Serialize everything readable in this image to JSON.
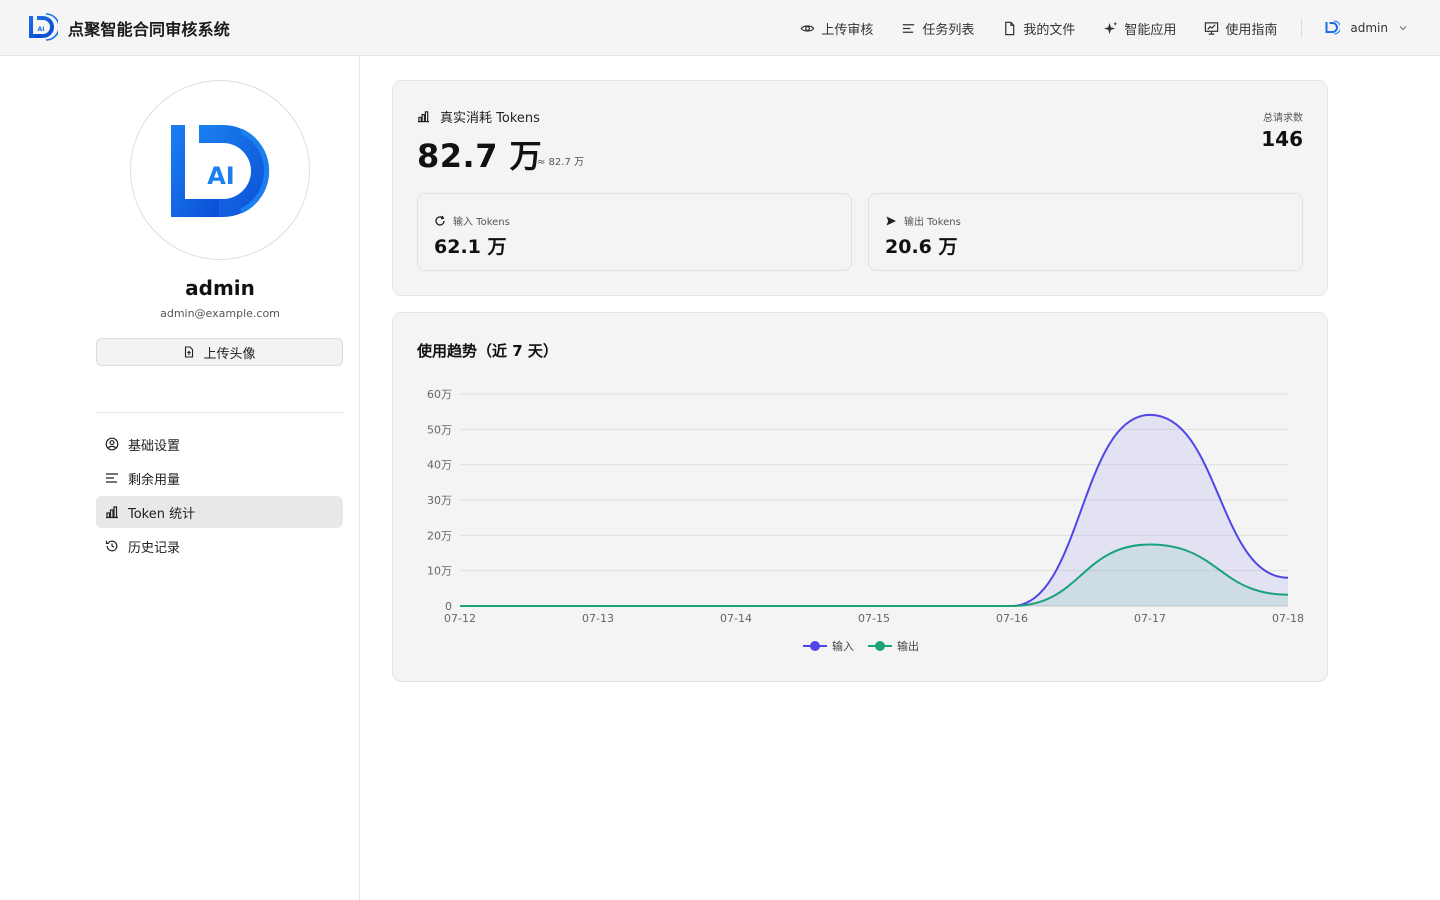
{
  "app": {
    "title": "点聚智能合同审核系统"
  },
  "nav": {
    "items": [
      {
        "label": "上传审核",
        "icon": "eye-icon"
      },
      {
        "label": "任务列表",
        "icon": "list-icon"
      },
      {
        "label": "我的文件",
        "icon": "file-icon"
      },
      {
        "label": "智能应用",
        "icon": "sparkle-icon"
      },
      {
        "label": "使用指南",
        "icon": "guide-icon"
      }
    ],
    "user": "admin"
  },
  "profile": {
    "avatar_text": "AI",
    "name": "admin",
    "email": "admin@example.com",
    "upload_label": "上传头像"
  },
  "sidebar": {
    "items": [
      {
        "label": "基础设置",
        "icon": "user-circle-icon",
        "active": false
      },
      {
        "label": "剩余用量",
        "icon": "list-icon",
        "active": false
      },
      {
        "label": "Token 统计",
        "icon": "bar-chart-icon",
        "active": true
      },
      {
        "label": "历史记录",
        "icon": "history-icon",
        "active": false
      }
    ]
  },
  "stats": {
    "label": "真实消耗 Tokens",
    "total": "82.7 万",
    "approx": "≈ 82.7 万",
    "requests_label": "总请求数",
    "requests_value": "146",
    "input_label": "输入 Tokens",
    "input_value": "62.1 万",
    "output_label": "输出 Tokens",
    "output_value": "20.6 万"
  },
  "chart_title": "使用趋势（近 7 天）",
  "colors": {
    "input": "#4f46e5",
    "output": "#1aa37a",
    "brand": "#1a73e8"
  },
  "chart_data": {
    "type": "area",
    "title": "",
    "x": [
      "07-12",
      "07-13",
      "07-14",
      "07-15",
      "07-16",
      "07-17",
      "07-18"
    ],
    "y_ticks": [
      "0",
      "10万",
      "20万",
      "30万",
      "40万",
      "50万",
      "60万"
    ],
    "ylim": [
      0,
      600000
    ],
    "grid": true,
    "legend": "bottom",
    "series": [
      {
        "name": "输入",
        "values": [
          0,
          0,
          0,
          0,
          0,
          541000,
          80000
        ]
      },
      {
        "name": "输出",
        "values": [
          0,
          0,
          0,
          0,
          0,
          174000,
          32000
        ]
      }
    ]
  }
}
